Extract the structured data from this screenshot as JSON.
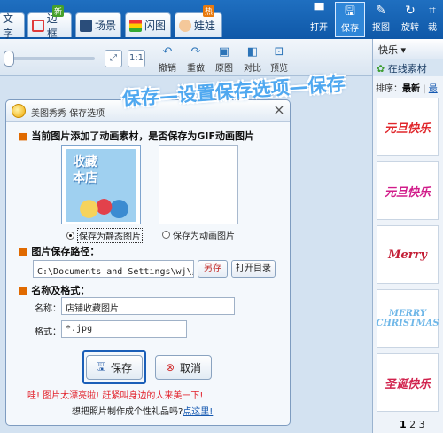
{
  "top_tabs": [
    {
      "label": "文字"
    },
    {
      "label": "边框",
      "badge": "新"
    },
    {
      "label": "场景"
    },
    {
      "label": "闪图"
    },
    {
      "label": "娃娃",
      "badge": "热"
    }
  ],
  "top_tools": [
    {
      "label": "打开",
      "icon": "folder-open-icon"
    },
    {
      "label": "保存",
      "icon": "floppy-save-icon",
      "active": true
    },
    {
      "label": "抠图",
      "icon": "magic-wand-icon"
    },
    {
      "label": "旋转",
      "icon": "rotate-icon"
    },
    {
      "label": "裁",
      "icon": "crop-icon"
    }
  ],
  "secondary_tools": [
    {
      "label": "撤销",
      "icon": "undo-icon"
    },
    {
      "label": "重做",
      "icon": "redo-icon"
    },
    {
      "label": "原图",
      "icon": "original-image-icon"
    },
    {
      "label": "对比",
      "icon": "compare-icon"
    },
    {
      "label": "预览",
      "icon": "preview-icon"
    }
  ],
  "zoom_buttons": {
    "fit": "⤢",
    "actual": "1:1"
  },
  "right_panel": {
    "category": "快乐",
    "online_label": "在线素材",
    "sort_label": "排序：",
    "sort_active": "最新",
    "sort_other": "最",
    "thumbnails": [
      {
        "text": "元旦快乐",
        "color": "#e0272c"
      },
      {
        "text": "元旦快乐",
        "color": "#d11c8a"
      },
      {
        "text": "Merry",
        "color": "#c31e35"
      },
      {
        "text": "MERRY CHRISTMAS",
        "color": "#6fb7e8"
      },
      {
        "text": "圣诞快乐",
        "color": "#d1224d"
      }
    ],
    "pages": [
      "1",
      "2",
      "3"
    ],
    "current_page": "1"
  },
  "annotation": "保存—设置保存选项—保存",
  "dialog": {
    "app_name": "美图秀秀",
    "title": "保存选项",
    "question": "当前图片添加了动画素材，是否保存为GIF动画图片",
    "preview_static_text": "收藏\n本店",
    "option_static": "保存为静态图片",
    "option_animated": "保存为动画图片",
    "selected_option": "static",
    "path_heading": "图片保存路径：",
    "path_value": "C:\\Documents and Settings\\wj\\桌",
    "save_as_button": "另存",
    "open_dir_button": "打开目录",
    "name_format_heading": "名称及格式：",
    "name_label": "名称：",
    "name_value": "店铺收藏图片",
    "format_label": "格式：",
    "format_value": "*.jpg",
    "save_button": "保存",
    "cancel_button": "取消",
    "warning_text": "哇! 图片太漂亮啦! 赶紧叫身边的人来美一下!",
    "gift_text": "想把照片制作成个性礼品吗?",
    "gift_link": "点这里!"
  }
}
